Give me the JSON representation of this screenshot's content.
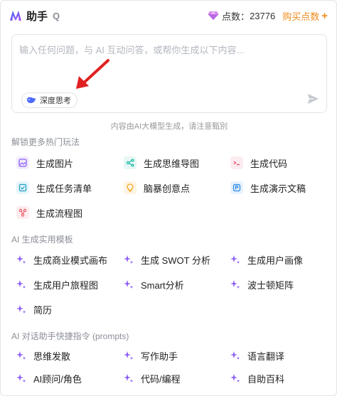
{
  "header": {
    "title": "助手",
    "help": "Q",
    "points_label": "点数：",
    "points_value": "23776",
    "buy_label": "购买点数",
    "buy_plus": "+"
  },
  "input": {
    "placeholder": "输入任何问题，与 AI 互动问答，或帮你生成以下内容...",
    "deep_think_label": "深度思考"
  },
  "notice": "内容由AI大模型生成，请注意甄别",
  "unlock": {
    "title": "解锁更多热门玩法",
    "items": [
      {
        "label": "生成图片",
        "icon": "image-icon",
        "color": "#8a5cf6",
        "bg": "#f1ecfe"
      },
      {
        "label": "生成思维导图",
        "icon": "mindmap-icon",
        "color": "#19b8a6",
        "bg": "#e6f7f5"
      },
      {
        "label": "生成代码",
        "icon": "code-icon",
        "color": "#f0506e",
        "bg": "#fdecef"
      },
      {
        "label": "生成任务清单",
        "icon": "checklist-icon",
        "color": "#1fa3c9",
        "bg": "#e6f5fa"
      },
      {
        "label": "脑暴创意点",
        "icon": "bulb-icon",
        "color": "#f2a41f",
        "bg": "#fef4e3"
      },
      {
        "label": "生成演示文稿",
        "icon": "slides-icon",
        "color": "#2e8ae6",
        "bg": "#e8f2fd"
      },
      {
        "label": "生成流程图",
        "icon": "flowchart-icon",
        "color": "#ef5b6c",
        "bg": "#fdecee"
      }
    ]
  },
  "templates": {
    "title": "AI 生成实用模板",
    "items": [
      "生成商业模式画布",
      "生成 SWOT 分析",
      "生成用户画像",
      "生成用户旅程图",
      "Smart分析",
      "波士顿矩阵",
      "简历"
    ]
  },
  "prompts": {
    "title": "AI 对话助手快捷指令 (prompts)",
    "items": [
      "思维发散",
      "写作助手",
      "语言翻译",
      "AI顾问/角色",
      "代码/编程",
      "自助百科"
    ]
  },
  "colors": {
    "accent_orange": "#f08a1c",
    "sparkle_purple": "#8b5cf6",
    "annotation_red": "#e02020"
  }
}
